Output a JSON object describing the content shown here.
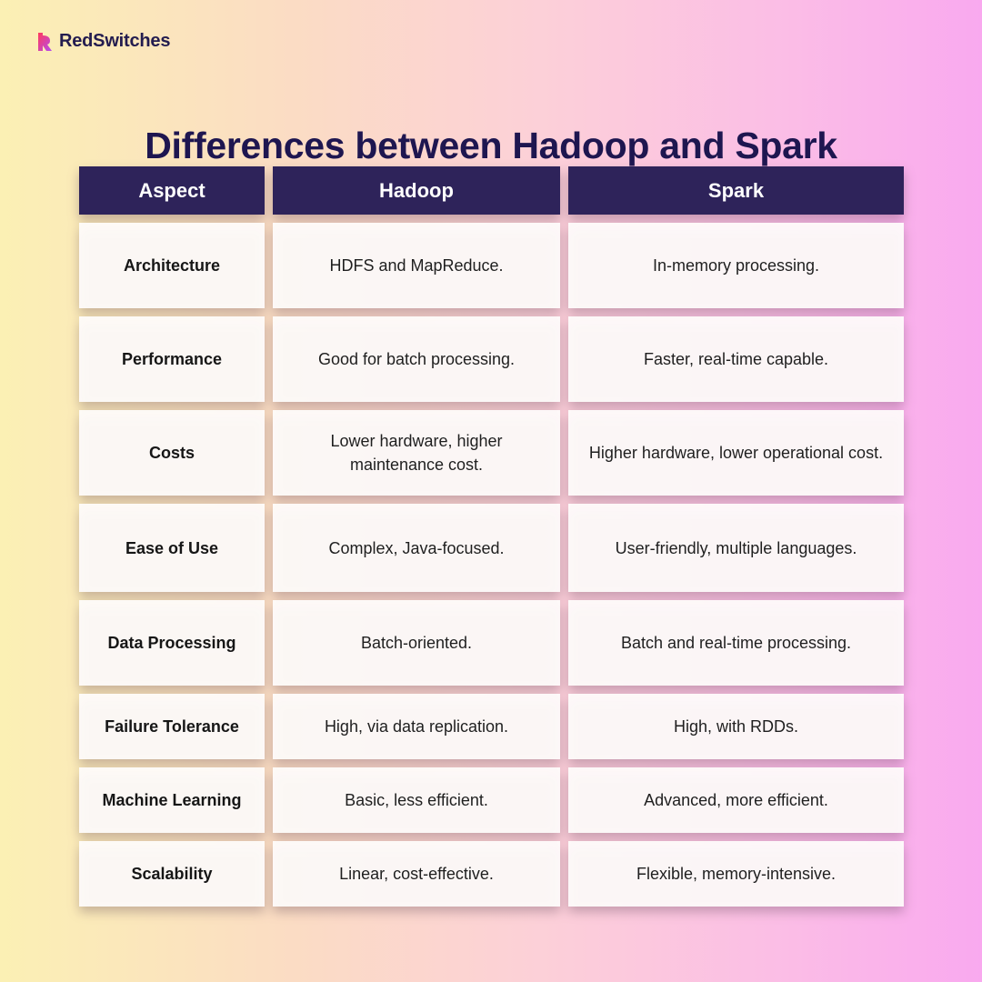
{
  "brand": {
    "name": "RedSwitches",
    "logo_icon": "redswitches-logo-icon",
    "colors": [
      "#ff3b5c",
      "#b44cf0"
    ]
  },
  "title": "Differences between Hadoop and Spark",
  "colors": {
    "header_bg": "#2e235a",
    "title": "#1e1650"
  },
  "table": {
    "headers": [
      "Aspect",
      "Hadoop",
      "Spark"
    ],
    "rows": [
      {
        "aspect": "Architecture",
        "hadoop": "HDFS and MapReduce.",
        "spark": "In-memory processing."
      },
      {
        "aspect": "Performance",
        "hadoop": "Good for batch processing.",
        "spark": "Faster, real-time capable."
      },
      {
        "aspect": "Costs",
        "hadoop": "Lower hardware, higher maintenance cost.",
        "spark": "Higher hardware, lower operational cost."
      },
      {
        "aspect": "Ease of Use",
        "hadoop": "Complex, Java-focused.",
        "spark": "User-friendly, multiple languages."
      },
      {
        "aspect": "Data Processing",
        "hadoop": "Batch-oriented.",
        "spark": "Batch and real-time processing."
      },
      {
        "aspect": "Failure Tolerance",
        "hadoop": "High, via data replication.",
        "spark": "High, with RDDs."
      },
      {
        "aspect": "Machine Learning",
        "hadoop": "Basic, less efficient.",
        "spark": "Advanced, more efficient."
      },
      {
        "aspect": "Scalability",
        "hadoop": "Linear, cost-effective.",
        "spark": "Flexible, memory-intensive."
      }
    ]
  }
}
